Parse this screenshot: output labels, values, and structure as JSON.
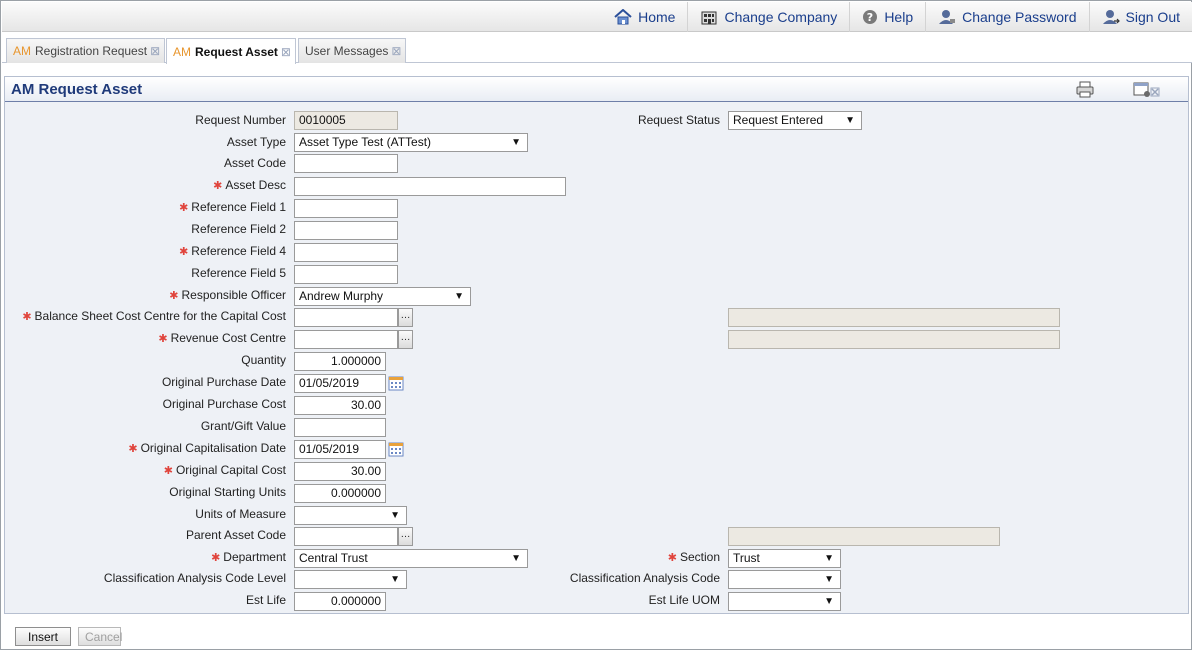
{
  "topnav": {
    "home": "Home",
    "change_company": "Change Company",
    "help": "Help",
    "change_password": "Change Password",
    "sign_out": "Sign Out"
  },
  "tabs": [
    {
      "prefix": "AM",
      "label": "Registration Request",
      "active": false
    },
    {
      "prefix": "AM",
      "label": "Request Asset",
      "active": true
    },
    {
      "prefix": "",
      "label": "User Messages",
      "active": false
    }
  ],
  "panel": {
    "title": "AM Request Asset"
  },
  "form": {
    "request_number": {
      "label": "Request Number",
      "value": "0010005"
    },
    "request_status": {
      "label": "Request Status",
      "value": "Request Entered"
    },
    "asset_type": {
      "label": "Asset Type",
      "value": "Asset Type Test (ATTest)"
    },
    "asset_code": {
      "label": "Asset Code",
      "value": ""
    },
    "asset_desc": {
      "label": "Asset Desc",
      "value": ""
    },
    "reference_field_1": {
      "label": "Reference Field 1",
      "value": ""
    },
    "reference_field_2": {
      "label": "Reference Field 2",
      "value": ""
    },
    "reference_field_4": {
      "label": "Reference Field 4",
      "value": ""
    },
    "reference_field_5": {
      "label": "Reference Field 5",
      "value": ""
    },
    "responsible_officer": {
      "label": "Responsible Officer",
      "value": "Andrew Murphy"
    },
    "balance_sheet_cost_centre": {
      "label": "Balance Sheet Cost Centre for the Capital Cost",
      "value": "",
      "description": ""
    },
    "revenue_cost_centre": {
      "label": "Revenue Cost Centre",
      "value": "",
      "description": ""
    },
    "quantity": {
      "label": "Quantity",
      "value": "1.000000"
    },
    "original_purchase_date": {
      "label": "Original Purchase Date",
      "value": "01/05/2019"
    },
    "original_purchase_cost": {
      "label": "Original Purchase Cost",
      "value": "30.00"
    },
    "grant_gift_value": {
      "label": "Grant/Gift Value",
      "value": ""
    },
    "original_capitalisation_date": {
      "label": "Original Capitalisation Date",
      "value": "01/05/2019"
    },
    "original_capital_cost": {
      "label": "Original Capital Cost",
      "value": "30.00"
    },
    "original_starting_units": {
      "label": "Original Starting Units",
      "value": "0.000000"
    },
    "units_of_measure": {
      "label": "Units of Measure",
      "value": ""
    },
    "parent_asset_code": {
      "label": "Parent Asset Code",
      "value": "",
      "description": ""
    },
    "department": {
      "label": "Department",
      "value": "Central Trust"
    },
    "section": {
      "label": "Section",
      "value": "Trust"
    },
    "classification_analysis_code_level": {
      "label": "Classification Analysis Code Level",
      "value": ""
    },
    "classification_analysis_code": {
      "label": "Classification Analysis Code",
      "value": ""
    },
    "est_life": {
      "label": "Est Life",
      "value": "0.000000"
    },
    "est_life_uom": {
      "label": "Est Life UOM",
      "value": ""
    }
  },
  "buttons": {
    "insert": "Insert",
    "cancel": "Cancel"
  },
  "colors": {
    "link": "#1a3e8c",
    "title": "#1f3a7a",
    "required": "#e0443c",
    "tab_prefix": "#e8962e"
  }
}
